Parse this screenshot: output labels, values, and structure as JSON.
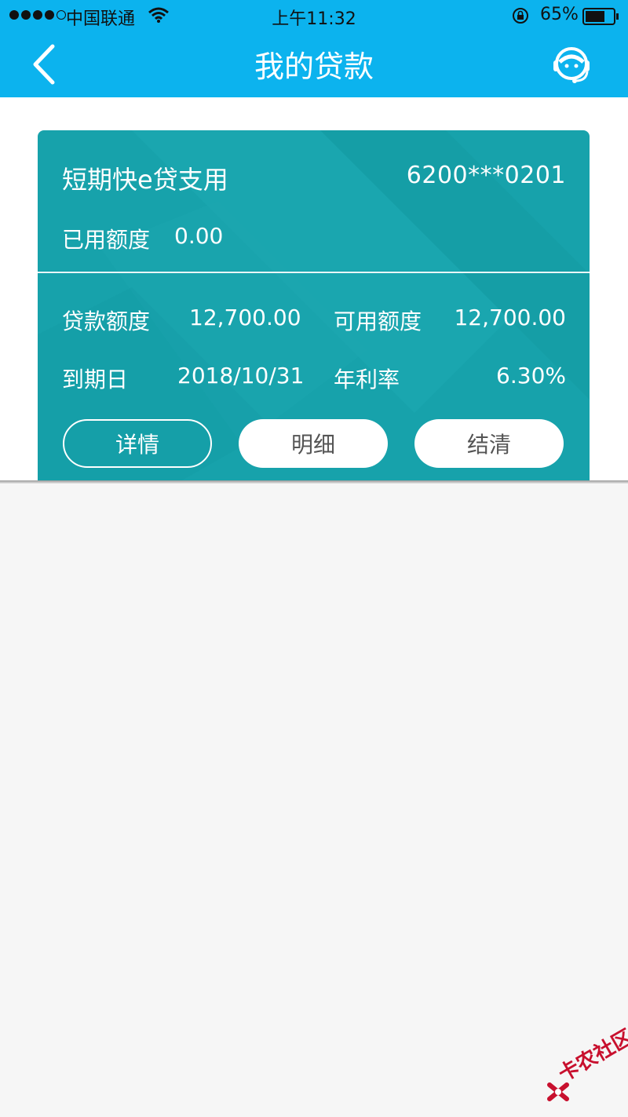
{
  "status_bar": {
    "carrier": "中国联通",
    "time": "上午11:32",
    "battery": "65%"
  },
  "nav": {
    "title": "我的贷款"
  },
  "loan_card": {
    "product_name": "短期快e贷支用",
    "card_number": "6200***0201",
    "used_label": "已用额度",
    "used_value": "0.00",
    "loan_limit_label": "贷款额度",
    "loan_limit_value": "12,700.00",
    "available_label": "可用额度",
    "available_value": "12,700.00",
    "due_date_label": "到期日",
    "due_date_value": "2018/10/31",
    "rate_label": "年利率",
    "rate_value": "6.30%",
    "buttons": {
      "details": "详情",
      "statement": "明细",
      "settle": "结清"
    }
  },
  "watermark": {
    "text": "卡农社区"
  },
  "colors": {
    "header": "#0cb3ee",
    "card": "#17a2ab",
    "background": "#f6f6f6"
  }
}
